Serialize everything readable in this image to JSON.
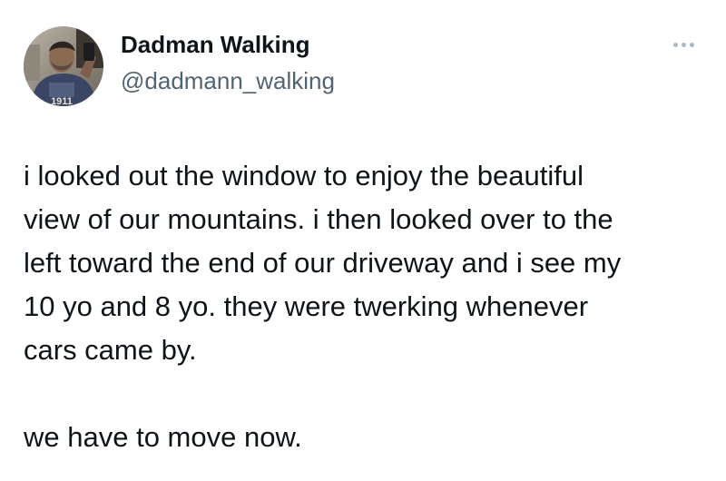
{
  "author": {
    "display_name": "Dadman Walking",
    "handle": "@dadmann_walking",
    "avatar_alt": "profile photo",
    "avatar_text": "1911"
  },
  "menu": {
    "more_icon": "more-horizontal-icon"
  },
  "tweet": {
    "paragraph1": [
      "i looked out the window to enjoy the beautiful",
      "view of our mountains. i then looked over to the",
      "left toward the end of our driveway and i see my",
      "10 yo and 8 yo. they were twerking whenever",
      "cars came by."
    ],
    "paragraph2": [
      "we have to move now."
    ]
  },
  "colors": {
    "text_primary": "#0f1419",
    "text_secondary": "#536471",
    "icon_muted": "#aab8c2"
  }
}
